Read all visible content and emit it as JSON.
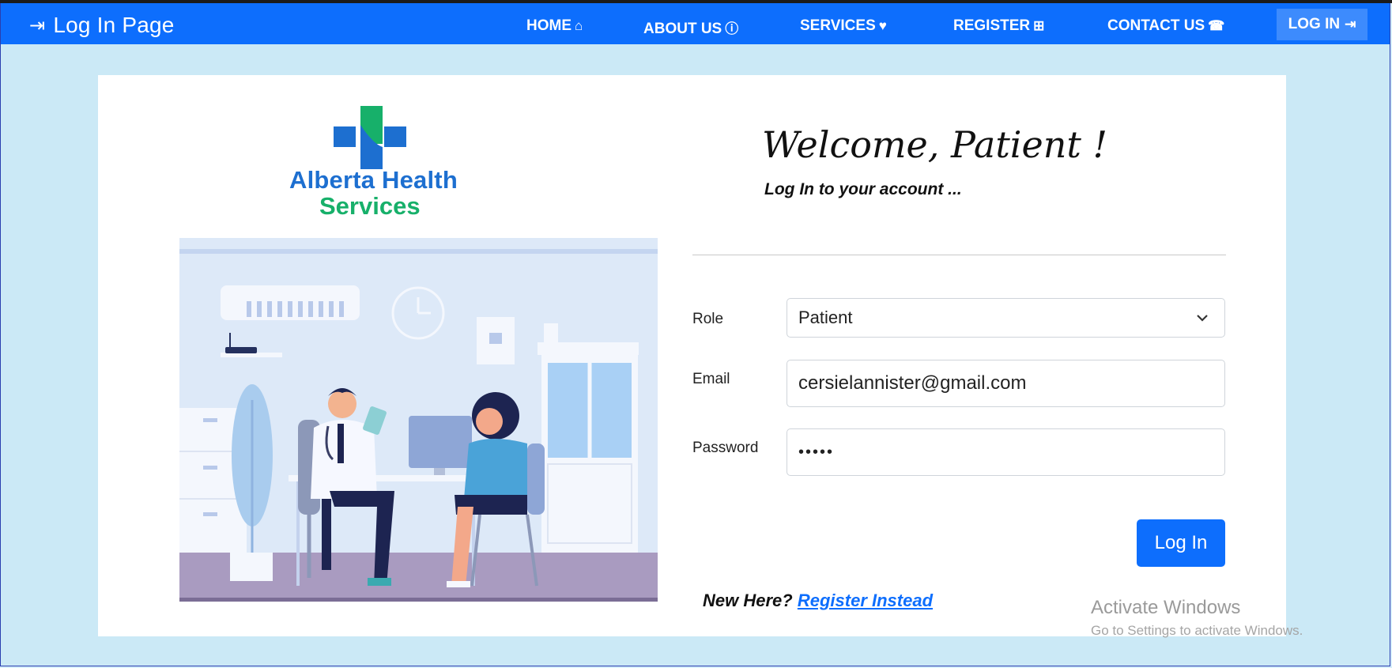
{
  "navbar": {
    "brand_icon": "login-icon",
    "brand": "Log In Page",
    "links": [
      {
        "label": "HOME",
        "icon": "home-icon",
        "glyph": "⌂"
      },
      {
        "label": "ABOUT US",
        "icon": "info-icon",
        "glyph": "ⓘ"
      },
      {
        "label": "SERVICES",
        "icon": "heart-icon",
        "glyph": "♥"
      },
      {
        "label": "REGISTER",
        "icon": "plus-square-icon",
        "glyph": "⊞"
      },
      {
        "label": "CONTACT US",
        "icon": "phone-icon",
        "glyph": "☎"
      }
    ],
    "login": {
      "label": "LOG IN",
      "icon": "login-icon",
      "glyph": "⇥"
    }
  },
  "logo": {
    "line1": "Alberta Health",
    "line2": "Services"
  },
  "form": {
    "welcome": "Welcome, Patient !",
    "subtitle": "Log In to your account ...",
    "role_label": "Role",
    "role_value": "Patient",
    "email_label": "Email",
    "email_value": "cersielannister@gmail.com",
    "password_label": "Password",
    "password_value": "•••••",
    "submit": "Log In",
    "new_here": "New Here?",
    "register_link": "Register Instead"
  },
  "watermark": {
    "line1": "Activate Windows",
    "line2": "Go to Settings to activate Windows."
  },
  "colors": {
    "primary": "#0d6efd",
    "page_bg": "#cbe9f6",
    "logo_blue": "#1d6fd0",
    "logo_green": "#17b06a"
  }
}
